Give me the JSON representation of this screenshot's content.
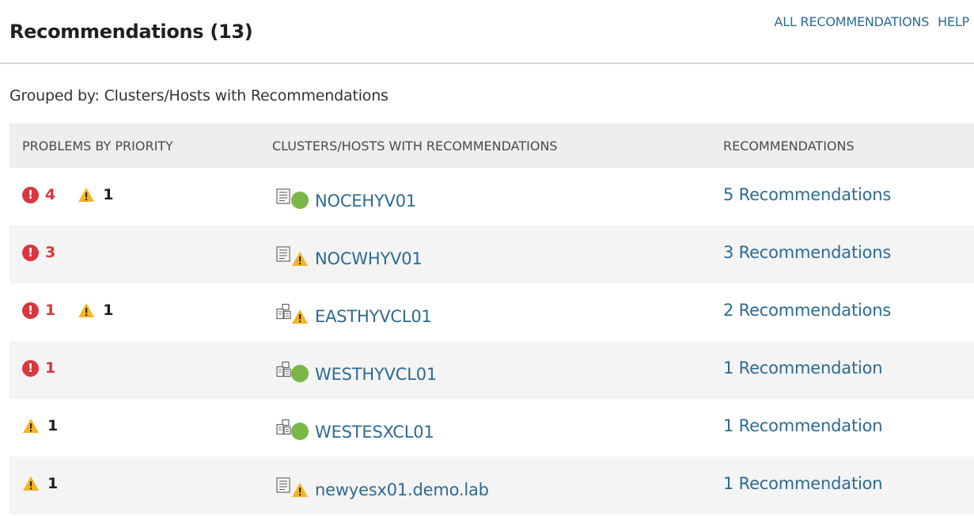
{
  "header": {
    "title": "Recommendations (13)",
    "links": {
      "all_recommendations": "ALL RECOMMENDATIONS",
      "help": "HELP"
    }
  },
  "grouped_by": "Grouped by: Clusters/Hosts with Recommendations",
  "table": {
    "columns": {
      "priority": "PROBLEMS BY PRIORITY",
      "objects": "CLUSTERS/HOSTS WITH RECOMMENDATIONS",
      "recommendations": "RECOMMENDATIONS"
    },
    "rows": [
      {
        "errors": "4",
        "warnings": "1",
        "object_type": "host-icon",
        "status": "ok",
        "name": "NOCEHYV01",
        "recommendations": "5 Recommendations"
      },
      {
        "errors": "3",
        "warnings": "",
        "object_type": "host-icon",
        "status": "warning",
        "name": "NOCWHYV01",
        "recommendations": "3 Recommendations"
      },
      {
        "errors": "1",
        "warnings": "1",
        "object_type": "cluster-icon",
        "status": "warning",
        "name": "EASTHYVCL01",
        "recommendations": "2 Recommendations"
      },
      {
        "errors": "1",
        "warnings": "",
        "object_type": "cluster-icon",
        "status": "ok",
        "name": "WESTHYVCL01",
        "recommendations": "1 Recommendation"
      },
      {
        "errors": "",
        "warnings": "1",
        "object_type": "cluster-icon",
        "status": "ok",
        "name": "WESTESXCL01",
        "recommendations": "1 Recommendation"
      },
      {
        "errors": "",
        "warnings": "1",
        "object_type": "host-icon",
        "status": "warning",
        "name": "newyesx01.demo.lab",
        "recommendations": "1 Recommendation"
      }
    ]
  },
  "colors": {
    "link": "#2d6a92",
    "error": "#d9363e",
    "warning": "#f2b523",
    "ok": "#7ab648"
  },
  "icons": {
    "error": "!"
  }
}
